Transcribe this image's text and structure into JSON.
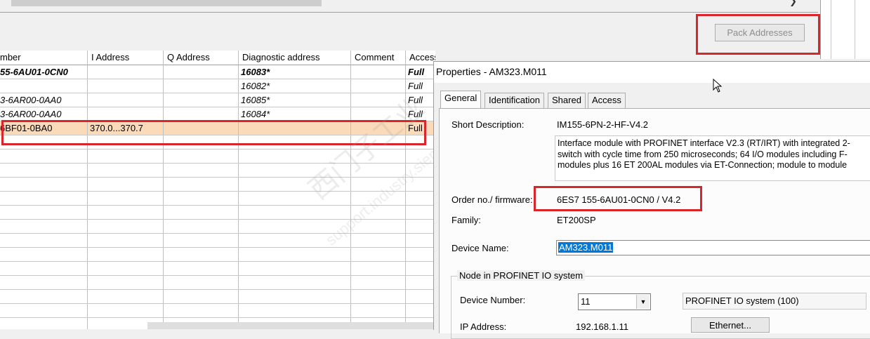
{
  "pack_button": {
    "label": "Pack Addresses"
  },
  "table": {
    "columns": [
      "mber",
      "I Address",
      "Q Address",
      "Diagnostic address",
      "Comment",
      "Access"
    ],
    "rows": [
      {
        "cells": [
          "55-6AU01-0CN0",
          "",
          "",
          "16083*",
          "",
          "Full"
        ],
        "style": "bold-italic"
      },
      {
        "cells": [
          "",
          "",
          "",
          "16082*",
          "",
          "Full"
        ],
        "style": "italic"
      },
      {
        "cells": [
          "3-6AR00-0AA0",
          "",
          "",
          "16085*",
          "",
          "Full"
        ],
        "style": "italic"
      },
      {
        "cells": [
          "3-6AR00-0AA0",
          "",
          "",
          "16084*",
          "",
          "Full"
        ],
        "style": "italic"
      },
      {
        "cells": [
          "6BF01-0BA0",
          "370.0...370.7",
          "",
          "",
          "",
          "Full"
        ],
        "style": "highlight"
      }
    ]
  },
  "dialog": {
    "title": "Properties - AM323.M011",
    "tabs": [
      "General",
      "Identification",
      "Shared",
      "Access"
    ],
    "active_tab": "General",
    "short_description_label": "Short Description:",
    "short_description_value": "IM155-6PN-2-HF-V4.2",
    "description_text": "Interface module with PROFINET interface V2.3 (RT/IRT) with integrated 2-switch with cycle time from 250 microseconds; 64 I/O modules including F-modules plus 16 ET 200AL modules via ET-Connection; module to module",
    "order_label": "Order no./ firmware:",
    "order_value": "6ES7 155-6AU01-0CN0 / V4.2",
    "family_label": "Family:",
    "family_value": "ET200SP",
    "device_name_label": "Device Name:",
    "device_name_value": "AM323.M011",
    "node_group_label": "Node in PROFINET IO system",
    "device_number_label": "Device Number:",
    "device_number_value": "11",
    "io_system_value": "PROFINET IO system (100)",
    "ip_label": "IP Address:",
    "ip_value": "192.168.1.11",
    "ethernet_button": "Ethernet..."
  },
  "watermark": {
    "line1": "西门子工业",
    "line2": "support.industry.siemens.com/cs"
  },
  "colors": {
    "highlight_row": "#fadab8",
    "red_annotation": "#d9262c",
    "selection": "#0078d7"
  }
}
